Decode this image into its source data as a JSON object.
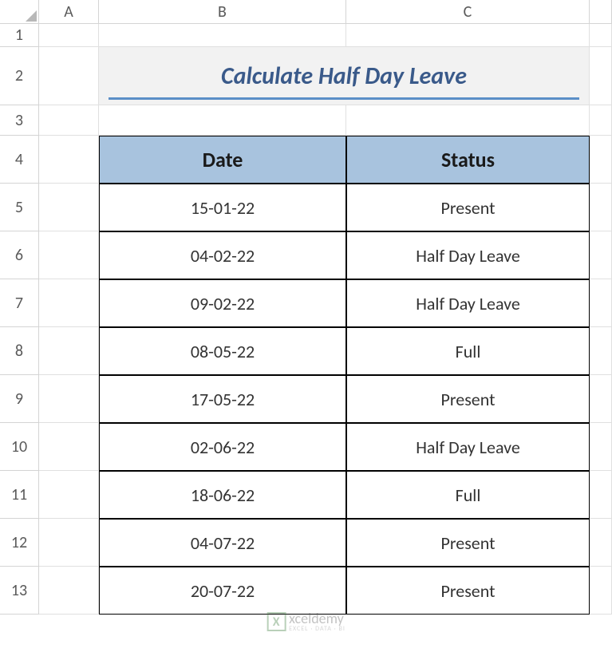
{
  "columns": [
    "A",
    "B",
    "C"
  ],
  "rows": [
    "1",
    "2",
    "3",
    "4",
    "5",
    "6",
    "7",
    "8",
    "9",
    "10",
    "11",
    "12",
    "13"
  ],
  "title": "Calculate Half Day Leave",
  "headers": {
    "date": "Date",
    "status": "Status"
  },
  "data": [
    {
      "date": "15-01-22",
      "status": "Present"
    },
    {
      "date": "04-02-22",
      "status": "Half Day Leave"
    },
    {
      "date": "09-02-22",
      "status": "Half Day Leave"
    },
    {
      "date": "08-05-22",
      "status": "Full"
    },
    {
      "date": "17-05-22",
      "status": "Present"
    },
    {
      "date": "02-06-22",
      "status": "Half Day Leave"
    },
    {
      "date": "18-06-22",
      "status": "Full"
    },
    {
      "date": "04-07-22",
      "status": "Present"
    },
    {
      "date": "20-07-22",
      "status": "Present"
    }
  ],
  "watermark": {
    "logo": "X",
    "main": "xceldemy",
    "sub": "EXCEL · DATA · BI"
  }
}
